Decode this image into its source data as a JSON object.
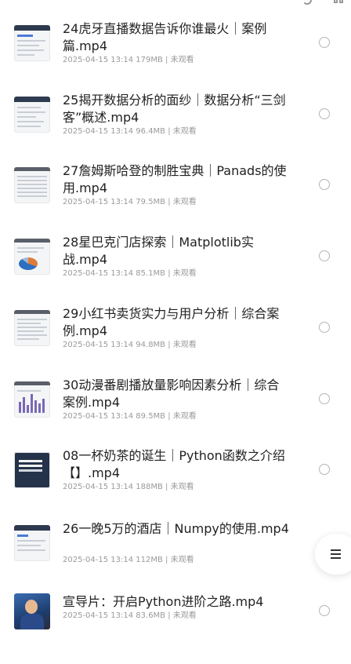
{
  "items": [
    {
      "title": "24虎牙直播数据告诉你谁最火｜案例篇.mp4",
      "meta": "2025-04-15 13:14  179MB | 未观看",
      "thumb": "chart"
    },
    {
      "title": "25揭开数据分析的面纱｜数据分析“三剑客”概述.mp4",
      "meta": "2025-04-15 13:14  96.4MB | 未观看",
      "thumb": "chart"
    },
    {
      "title": "27詹姆斯哈登的制胜宝典｜Panads的使用.mp4",
      "meta": "2025-04-15 13:14  79.5MB | 未观看",
      "thumb": "table"
    },
    {
      "title": "28星巴克门店探索｜Matplotlib实战.mp4",
      "meta": "2025-04-15 13:14  85.1MB | 未观看",
      "thumb": "pie"
    },
    {
      "title": "29小红书卖货实力与用户分析｜综合案例.mp4",
      "meta": "2025-04-15 13:14  94.8MB | 未观看",
      "thumb": "table"
    },
    {
      "title": "30动漫番剧播放量影响因素分析｜综合案例.mp4",
      "meta": "2025-04-15 13:14  89.5MB | 未观看",
      "thumb": "bars"
    },
    {
      "title": "08一杯奶茶的诞生｜Python函数之介绍【】.mp4",
      "meta": "2025-04-15 13:14  188MB | 未观看",
      "thumb": "dark"
    },
    {
      "title": "26一晚5万的酒店｜Numpy的使用.mp4",
      "meta": "2025-04-15 13:14  112MB | 未观看",
      "thumb": "chart"
    },
    {
      "title": "宣导片：开启Python进阶之路.mp4",
      "meta": "2025-04-15 13:14  83.6MB | 未观看",
      "thumb": "photo"
    }
  ],
  "icons": {
    "radio": "radio-unchecked-icon",
    "float": "menu-icon"
  }
}
